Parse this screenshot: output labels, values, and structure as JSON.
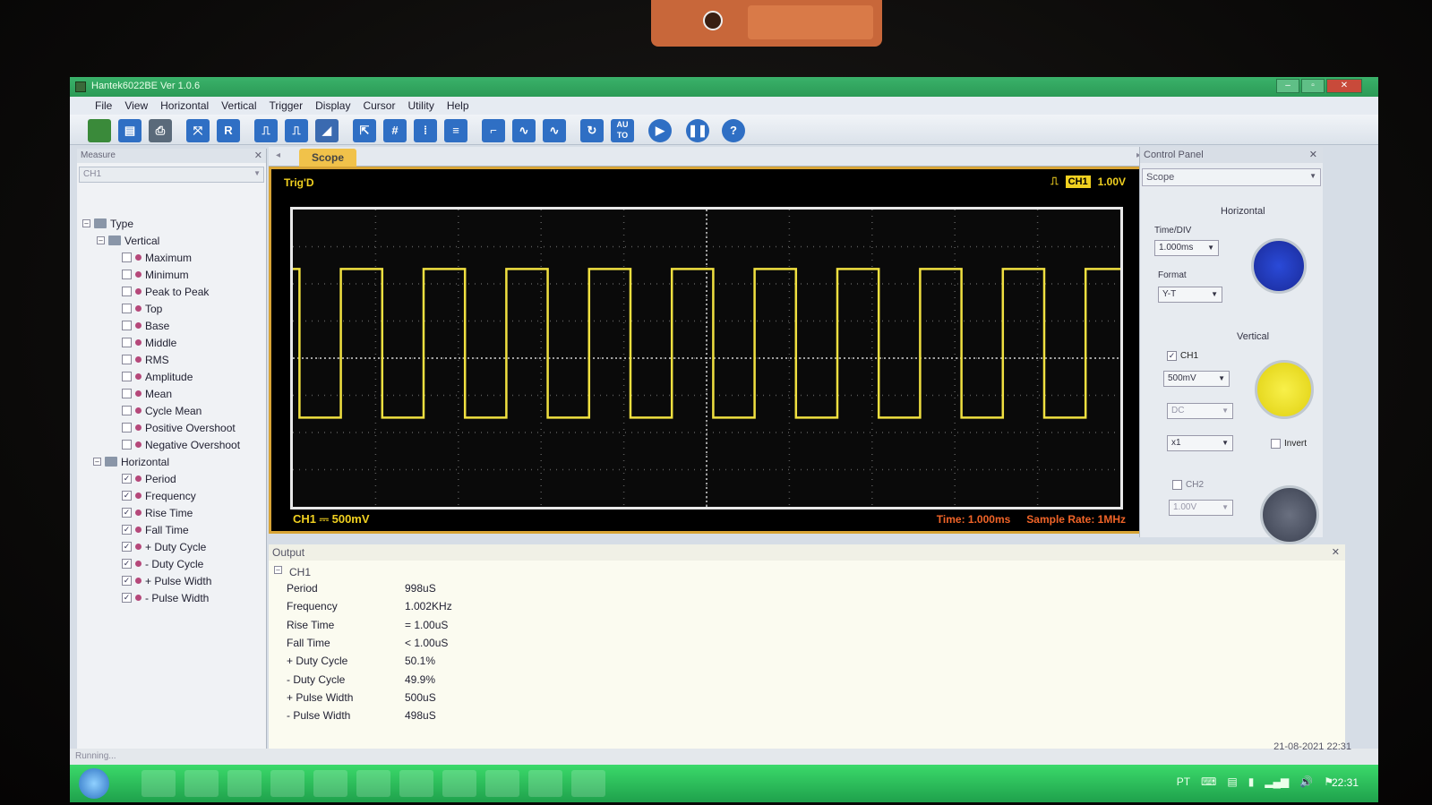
{
  "window": {
    "title": "Hantek6022BE Ver 1.0.6"
  },
  "menu": [
    "File",
    "View",
    "Horizontal",
    "Vertical",
    "Trigger",
    "Display",
    "Cursor",
    "Utility",
    "Help"
  ],
  "toolbar": {
    "auto_label": "AU TO",
    "help_label": "?",
    "r_label": "R"
  },
  "measure_panel": {
    "title": "Measure",
    "select_value": "CH1",
    "tree": {
      "root": "Type",
      "vertical_group": "Vertical",
      "horizontal_group": "Horizontal",
      "vertical_items": [
        "Maximum",
        "Minimum",
        "Peak to Peak",
        "Top",
        "Base",
        "Middle",
        "RMS",
        "Amplitude",
        "Mean",
        "Cycle Mean",
        "Positive Overshoot",
        "Negative Overshoot"
      ],
      "horizontal_items": [
        "Period",
        "Frequency",
        "Rise Time",
        "Fall Time",
        "+ Duty Cycle",
        "- Duty Cycle",
        "+ Pulse Width",
        "- Pulse Width"
      ]
    }
  },
  "scope": {
    "tab_label": "Scope",
    "trig_status": "Trig'D",
    "trig_channel": "CH1",
    "trig_level": "1.00V",
    "ch_label": "CH1 ⎓  500mV",
    "time_info": "Time: 1.000ms",
    "sample_rate": "Sample Rate: 1MHz",
    "waveform": {
      "type": "square",
      "cycles_visible": 10,
      "duty_cycle": 0.5
    }
  },
  "output": {
    "title": "Output",
    "channel": "CH1",
    "rows": [
      {
        "label": "Period",
        "value": "998uS"
      },
      {
        "label": "Frequency",
        "value": "1.002KHz"
      },
      {
        "label": "Rise Time",
        "value": "= 1.00uS"
      },
      {
        "label": "Fall Time",
        "value": "< 1.00uS"
      },
      {
        "label": "+ Duty Cycle",
        "value": "50.1%"
      },
      {
        "label": "- Duty Cycle",
        "value": "49.9%"
      },
      {
        "label": "+ Pulse Width",
        "value": "500uS"
      },
      {
        "label": "- Pulse Width",
        "value": "498uS"
      }
    ]
  },
  "control_panel": {
    "title": "Control Panel",
    "select_value": "Scope",
    "horizontal": "Horizontal",
    "timediv_label": "Time/DIV",
    "timediv_value": "1.000ms",
    "format_label": "Format",
    "format_value": "Y-T",
    "vertical": "Vertical",
    "ch1": "CH1",
    "ch1_volts": "500mV",
    "coupling": "DC",
    "probe": "x1",
    "invert": "Invert",
    "ch2": "CH2",
    "ch2_volts": "1.00V"
  },
  "status": {
    "text": "Running..."
  },
  "taskbar": {
    "lang": "PT",
    "clock": "22:31",
    "date": "21-08-2021  22:31"
  },
  "colors": {
    "trace": "#f0e040",
    "accent_orange": "#f06428",
    "taskbar": "#2fbf5a"
  }
}
